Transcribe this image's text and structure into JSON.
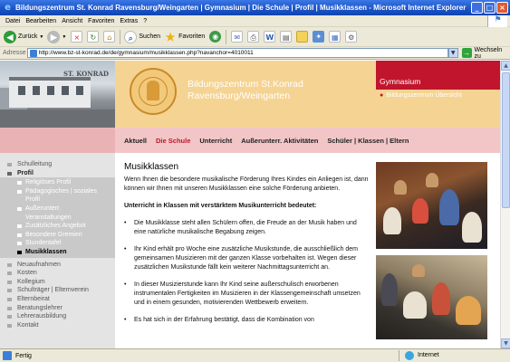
{
  "window": {
    "title": "Bildungszentrum St. Konrad Ravensburg/Weingarten | Gymnasium | Die Schule | Profil | Musikklassen - Microsoft Internet Explorer"
  },
  "menu": [
    "Datei",
    "Bearbeiten",
    "Ansicht",
    "Favoriten",
    "Extras",
    "?"
  ],
  "toolbar": {
    "back_label": "Zurück",
    "search_label": "Suchen",
    "favorites_label": "Favoriten"
  },
  "address": {
    "label": "Adresse",
    "url": "http://www.bz-st-konrad.de/de/gymnasium/musikklassen.php?navanchor=4010011",
    "go_label": "Wechseln zu"
  },
  "header": {
    "photo_sign": "ST. KONRAD",
    "brand_line1": "Bildungszentrum St.Konrad",
    "brand_line2": "Ravensburg/Weingarten",
    "section": "Gymnasium",
    "overview_link": "Bildungszentrum Übersicht"
  },
  "nav": {
    "items": [
      "Aktuell",
      "Die Schule",
      "Unterricht",
      "Außerunterr. Aktivitäten",
      "Schüler | Klassen | Eltern"
    ],
    "active_index": 1
  },
  "sidebar": {
    "top": [
      "Schulleitung",
      "Profil"
    ],
    "profil_sub": [
      "Religiöses Profil",
      "Pädagogisches | soziales Profil",
      "Außerunterr. Veranstaltungen",
      "Zusätzliches Angebot",
      "Besondere Gremien",
      "Stundentafel",
      "Musikklassen"
    ],
    "bottom": [
      "Neuaufnahmen",
      "Kosten",
      "Kollegium",
      "Schulträger | Elternverein",
      "Elternbeirat",
      "Beratungslehrer",
      "Lehrerausbildung",
      "Kontakt"
    ]
  },
  "content": {
    "title": "Musikklassen",
    "intro": "Wenn Ihnen die besondere musikalische Förderung Ihres Kindes ein Anliegen ist, dann können wir Ihnen mit unseren Musikklassen eine solche Förderung anbieten.",
    "subheading": "Unterricht in Klassen mit verstärktem Musikunterricht bedeutet:",
    "bullets": [
      "Die Musikklasse steht allen Schülern offen, die Freude an der Musik haben und eine natürliche musikalische Begabung zeigen.",
      "Ihr Kind erhält pro Woche eine zusätzliche Musikstunde, die ausschließlich dem gemeinsamen Musizieren mit der ganzen Klasse vorbehalten ist. Wegen dieser zusätzlichen Musikstunde fällt kein weiterer Nachmittagsunterricht an.",
      "In dieser Musizierstunde kann Ihr Kind seine außerschulisch erworbenen instrumentalen Fertigkeiten im Musizieren in der Klassengemeinschaft umsetzen und in einem gesunden, motivierenden Wettbewerb erweitern.",
      "Es hat sich in der Erfahrung bestätigt, dass die Kombination von"
    ]
  },
  "status": {
    "left": "Fertig",
    "zone": "Internet"
  }
}
